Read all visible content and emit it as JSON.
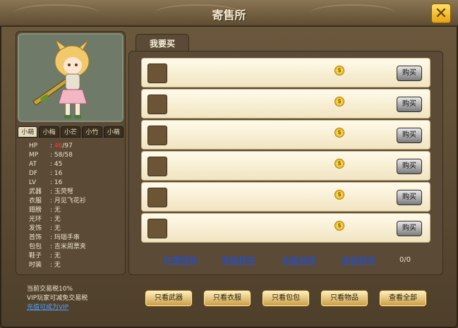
{
  "window": {
    "title": "寄售所"
  },
  "colors": {
    "panel": "#5a4a36",
    "accent_gold": "#e3a80a",
    "link_blue": "#1d4fe0"
  },
  "icons": {
    "close": "close-icon",
    "coin": "coin-icon"
  },
  "tabs": {
    "buy": "我要买"
  },
  "character_tabs": [
    "小萌",
    "小梅",
    "小芒",
    "小竹",
    "小萌"
  ],
  "stats": [
    {
      "key": "HP",
      "value": "97"
    },
    {
      "key": "MP",
      "value": "58/58"
    },
    {
      "key": "AT",
      "value": "45"
    },
    {
      "key": "DF",
      "value": "16"
    },
    {
      "key": "LV",
      "value": "16"
    },
    {
      "key": "武器",
      "value": "玉荧弩"
    },
    {
      "key": "衣服",
      "value": "月见飞花衫"
    },
    {
      "key": "翅膀",
      "value": "无"
    },
    {
      "key": "光环",
      "value": "无"
    },
    {
      "key": "发饰",
      "value": "无"
    },
    {
      "key": "首饰",
      "value": "玛瑙手串"
    },
    {
      "key": "包包",
      "value": "吉米周票夹"
    },
    {
      "key": "鞋子",
      "value": "无"
    },
    {
      "key": "时装",
      "value": "无"
    }
  ],
  "hp_current": "46",
  "list": {
    "buy_label": "购买",
    "rows": 6
  },
  "sort_links": [
    "种类排序",
    "等级排序",
    "价格排序",
    "卖家排序"
  ],
  "page_indicator": "0/0",
  "tax": {
    "line1": "当前交易税10%",
    "line2": "VIP玩家可减免交易税",
    "line3": "充值可成为VIP"
  },
  "filters": [
    "只看武器",
    "只看衣服",
    "只看包包",
    "只看物品",
    "查看全部"
  ]
}
